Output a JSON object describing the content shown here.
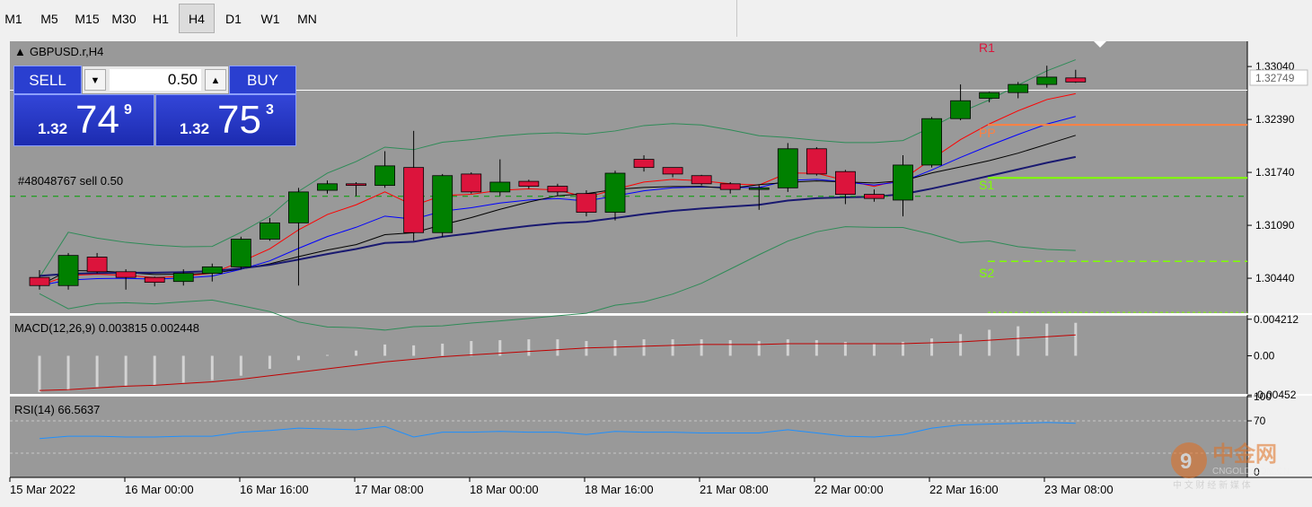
{
  "toolbar": {
    "timeframes": [
      "M1",
      "M5",
      "M15",
      "M30",
      "H1",
      "H4",
      "D1",
      "W1",
      "MN"
    ],
    "active": "H4"
  },
  "chart": {
    "symbol_label": "GBPUSD.r,H4",
    "order_label": "#48048767 sell 0.50",
    "current_price": "1.32749",
    "price_ticks": [
      "1.33040",
      "1.32390",
      "1.31740",
      "1.31090",
      "1.30440"
    ],
    "pivot_labels": {
      "r1": "R1",
      "pp": "PP",
      "s1": "S1",
      "s2": "S2"
    },
    "date_labels": [
      "15 Mar 2022",
      "16 Mar 00:00",
      "16 Mar 16:00",
      "17 Mar 08:00",
      "18 Mar 00:00",
      "18 Mar 16:00",
      "21 Mar 08:00",
      "22 Mar 00:00",
      "22 Mar 16:00",
      "23 Mar 08:00"
    ],
    "colors": {
      "background": "#999999",
      "bull": "#008000",
      "bear": "#dc143c",
      "text": "#000000",
      "pivot": "#ff8040",
      "support": "#7fff00"
    }
  },
  "trade_panel": {
    "sell_label": "SELL",
    "buy_label": "BUY",
    "lot": "0.50",
    "sell_small": "1.32",
    "sell_big": "74",
    "sell_sup": "9",
    "buy_small": "1.32",
    "buy_big": "75",
    "buy_sup": "3"
  },
  "macd": {
    "label": "MACD(12,26,9) 0.003815 0.002448",
    "ticks": [
      "0.004212",
      "0.00",
      "-0.00452"
    ]
  },
  "rsi": {
    "label": "RSI(14) 66.5637",
    "ticks": [
      "100",
      "70",
      "0"
    ]
  },
  "watermark": {
    "brand": "中金网",
    "site": "CNGOLD.COM.CN",
    "slogan": "中 文 财 经 新 媒 体"
  },
  "chart_data": {
    "type": "candlestick",
    "symbol": "GBPUSD.r",
    "timeframe": "H4",
    "candles": [
      {
        "o": 1.3045,
        "h": 1.3054,
        "l": 1.303,
        "c": 1.3035
      },
      {
        "o": 1.3035,
        "h": 1.3075,
        "l": 1.303,
        "c": 1.3072
      },
      {
        "o": 1.307,
        "h": 1.3075,
        "l": 1.305,
        "c": 1.3052
      },
      {
        "o": 1.3052,
        "h": 1.3055,
        "l": 1.303,
        "c": 1.3045
      },
      {
        "o": 1.3045,
        "h": 1.3046,
        "l": 1.3034,
        "c": 1.3039
      },
      {
        "o": 1.304,
        "h": 1.3055,
        "l": 1.3035,
        "c": 1.305
      },
      {
        "o": 1.305,
        "h": 1.3062,
        "l": 1.304,
        "c": 1.3058
      },
      {
        "o": 1.3058,
        "h": 1.3095,
        "l": 1.3055,
        "c": 1.3092
      },
      {
        "o": 1.3092,
        "h": 1.3118,
        "l": 1.309,
        "c": 1.3112
      },
      {
        "o": 1.3112,
        "h": 1.3155,
        "l": 1.3035,
        "c": 1.315
      },
      {
        "o": 1.3152,
        "h": 1.3164,
        "l": 1.3148,
        "c": 1.316
      },
      {
        "o": 1.316,
        "h": 1.3162,
        "l": 1.3145,
        "c": 1.3158
      },
      {
        "o": 1.3158,
        "h": 1.32,
        "l": 1.3155,
        "c": 1.3182
      },
      {
        "o": 1.318,
        "h": 1.3225,
        "l": 1.309,
        "c": 1.31
      },
      {
        "o": 1.31,
        "h": 1.3172,
        "l": 1.3095,
        "c": 1.317
      },
      {
        "o": 1.3172,
        "h": 1.3174,
        "l": 1.3148,
        "c": 1.315
      },
      {
        "o": 1.315,
        "h": 1.319,
        "l": 1.3145,
        "c": 1.3162
      },
      {
        "o": 1.3163,
        "h": 1.3165,
        "l": 1.3154,
        "c": 1.3157
      },
      {
        "o": 1.3157,
        "h": 1.316,
        "l": 1.3145,
        "c": 1.315
      },
      {
        "o": 1.3148,
        "h": 1.3152,
        "l": 1.312,
        "c": 1.3125
      },
      {
        "o": 1.3125,
        "h": 1.3176,
        "l": 1.3115,
        "c": 1.3173
      },
      {
        "o": 1.319,
        "h": 1.3195,
        "l": 1.3175,
        "c": 1.318
      },
      {
        "o": 1.318,
        "h": 1.318,
        "l": 1.3168,
        "c": 1.3172
      },
      {
        "o": 1.317,
        "h": 1.3171,
        "l": 1.3158,
        "c": 1.316
      },
      {
        "o": 1.316,
        "h": 1.3162,
        "l": 1.3148,
        "c": 1.3153
      },
      {
        "o": 1.3153,
        "h": 1.3158,
        "l": 1.3128,
        "c": 1.3155
      },
      {
        "o": 1.3155,
        "h": 1.321,
        "l": 1.315,
        "c": 1.3203
      },
      {
        "o": 1.3203,
        "h": 1.3205,
        "l": 1.317,
        "c": 1.3172
      },
      {
        "o": 1.3175,
        "h": 1.3177,
        "l": 1.3135,
        "c": 1.3147
      },
      {
        "o": 1.3147,
        "h": 1.3153,
        "l": 1.3138,
        "c": 1.3142
      },
      {
        "o": 1.314,
        "h": 1.3195,
        "l": 1.312,
        "c": 1.3183
      },
      {
        "o": 1.3183,
        "h": 1.3242,
        "l": 1.318,
        "c": 1.324
      },
      {
        "o": 1.324,
        "h": 1.3282,
        "l": 1.3238,
        "c": 1.3262
      },
      {
        "o": 1.3265,
        "h": 1.3273,
        "l": 1.326,
        "c": 1.3272
      },
      {
        "o": 1.3272,
        "h": 1.3285,
        "l": 1.3265,
        "c": 1.3282
      },
      {
        "o": 1.3282,
        "h": 1.3305,
        "l": 1.3278,
        "c": 1.3291
      },
      {
        "o": 1.329,
        "h": 1.33,
        "l": 1.3284,
        "c": 1.3285
      }
    ],
    "ylim": [
      1.3,
      1.3335
    ],
    "macd_hist": [
      -0.0042,
      -0.004,
      -0.0036,
      -0.0035,
      -0.0034,
      -0.0031,
      -0.0028,
      -0.0023,
      -0.0015,
      -0.0005,
      0.0001,
      0.0006,
      0.0013,
      0.0012,
      0.0014,
      0.0017,
      0.0018,
      0.0019,
      0.0019,
      0.0017,
      0.0018,
      0.0019,
      0.0019,
      0.0019,
      0.0018,
      0.0017,
      0.0019,
      0.0018,
      0.0016,
      0.0014,
      0.0016,
      0.002,
      0.0025,
      0.003,
      0.0034,
      0.0037,
      0.0038
    ],
    "macd_signal": [
      -0.004,
      -0.0039,
      -0.0037,
      -0.0035,
      -0.0034,
      -0.0032,
      -0.003,
      -0.0027,
      -0.0023,
      -0.0019,
      -0.0015,
      -0.0011,
      -0.0007,
      -0.0004,
      -0.0001,
      0.0001,
      0.0003,
      0.0005,
      0.0007,
      0.0009,
      0.001,
      0.0011,
      0.0012,
      0.0013,
      0.0013,
      0.0013,
      0.0014,
      0.0014,
      0.0014,
      0.0014,
      0.0014,
      0.0015,
      0.0016,
      0.0018,
      0.002,
      0.0022,
      0.0024
    ],
    "macd_ylim": [
      -0.0045,
      0.0046
    ],
    "rsi": [
      48,
      51,
      51,
      50,
      50,
      51,
      51,
      56,
      58,
      61,
      60,
      59,
      63,
      50,
      56,
      56,
      57,
      56,
      56,
      53,
      57,
      56,
      56,
      55,
      55,
      55,
      59,
      55,
      51,
      50,
      53,
      61,
      65,
      66,
      67,
      68,
      67
    ],
    "rsi_ylim": [
      0,
      100
    ]
  }
}
